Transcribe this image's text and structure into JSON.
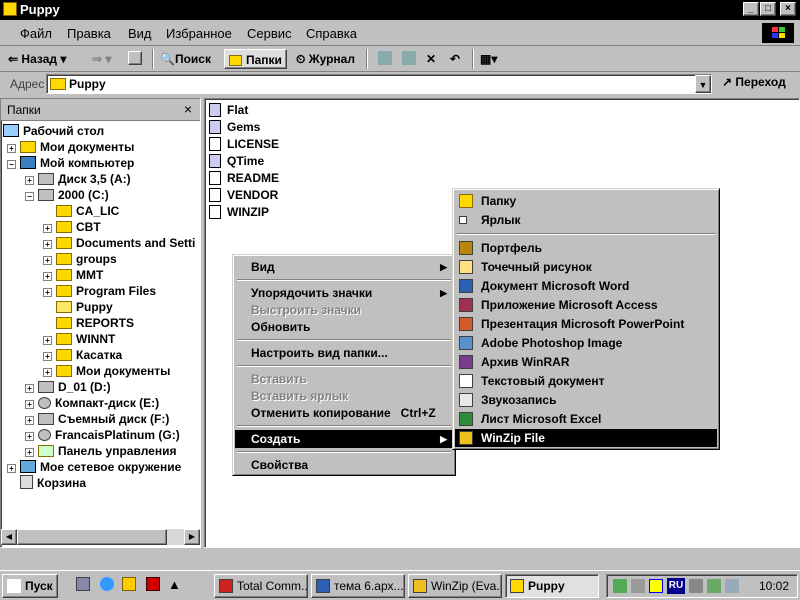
{
  "window": {
    "title": "Puppy"
  },
  "menubar": [
    "Файл",
    "Правка",
    "Вид",
    "Избранное",
    "Сервис",
    "Справка"
  ],
  "toolbar": {
    "back": "Назад",
    "search": "Поиск",
    "folders": "Папки",
    "history": "Журнал"
  },
  "address": {
    "label": "Адрес",
    "value": "Puppy",
    "go": "Переход"
  },
  "folders_pane": {
    "title": "Папки",
    "close": "×",
    "tree": [
      "Рабочий стол",
      "Мои документы",
      "Мой компьютер",
      "Диск 3,5 (A:)",
      "2000 (C:)",
      "CA_LIC",
      "CBT",
      "Documents and Setti",
      "groups",
      "MMT",
      "Program Files",
      "Puppy",
      "REPORTS",
      "WINNT",
      "Касатка",
      "Мои документы",
      "D_01 (D:)",
      "Компакт-диск (E:)",
      "Съемный диск (F:)",
      "FrancaisPlatinum (G:)",
      "Панель управления",
      "Мое сетевое окружение",
      "Корзина"
    ]
  },
  "files": [
    "Flat",
    "Gems",
    "LICENSE",
    "QTime",
    "README",
    "VENDOR",
    "WINZIP"
  ],
  "context_menu": {
    "view": "Вид",
    "arrange": "Упорядочить значки",
    "lineup": "Выстроить значки",
    "refresh": "Обновить",
    "customize": "Настроить вид папки...",
    "paste": "Вставить",
    "paste_shortcut": "Вставить ярлык",
    "undo": "Отменить копирование",
    "undo_key": "Ctrl+Z",
    "new": "Создать",
    "properties": "Свойства"
  },
  "new_submenu": {
    "folder": "Папку",
    "shortcut": "Ярлык",
    "briefcase": "Портфель",
    "bitmap": "Точечный рисунок",
    "word": "Документ Microsoft Word",
    "access": "Приложение Microsoft Access",
    "powerpoint": "Презентация Microsoft PowerPoint",
    "photoshop": "Adobe Photoshop Image",
    "winrar": "Архив WinRAR",
    "text": "Текстовый документ",
    "sound": "Звукозапись",
    "excel": "Лист Microsoft Excel",
    "winzip": "WinZip File"
  },
  "taskbar": {
    "start": "Пуск",
    "tasks": [
      "Total Comm...",
      "тема 6.арх...",
      "WinZip (Eva...",
      "Puppy"
    ],
    "lang": "RU",
    "clock": "10:02"
  }
}
